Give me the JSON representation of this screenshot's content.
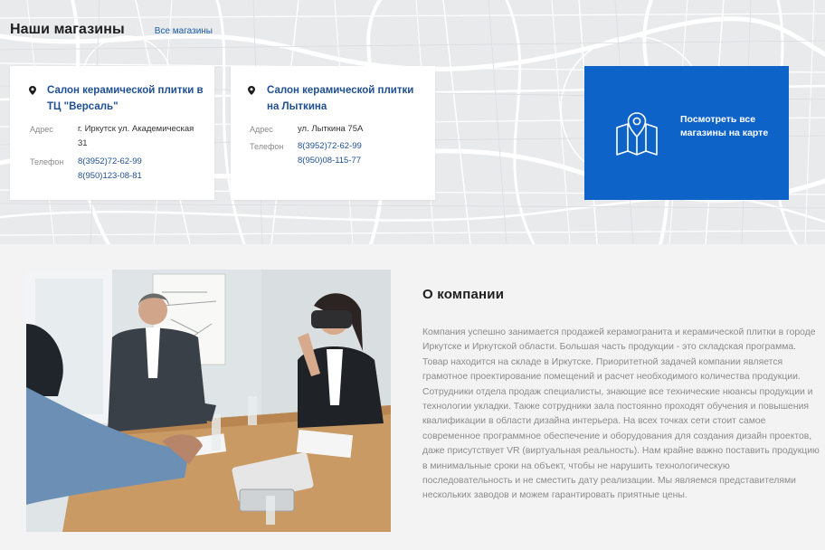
{
  "stores": {
    "title": "Наши магазины",
    "all_link": "Все магазины",
    "address_label": "Адрес",
    "phone_label": "Телефон",
    "items": [
      {
        "name": "Салон керамической плитки в ТЦ \"Версаль\"",
        "address": "г. Иркутск ул. Академическая 31",
        "phones": [
          "8(3952)72-62-99",
          "8(950)123-08-81"
        ]
      },
      {
        "name": "Салон керамической плитки на Лыткина",
        "address": "ул. Лыткина 75А",
        "phones": [
          "8(3952)72-62-99",
          "8(950)08-115-77"
        ]
      }
    ],
    "map_button": {
      "label": "Посмотреть все магазины на карте",
      "icon": "folded-map-pin-icon"
    }
  },
  "about": {
    "title": "О компании",
    "text": "Компания успешно занимается продажей керамогранита и керамической плитки в городе Иркутске и Иркутской области. Большая часть продукции - это складская программа. Товар находится на складе в Иркутске. Приоритетной задачей компании является грамотное проектирование помещений и расчет необходимого количества продукции. Сотрудники отдела продаж специалисты, знающие все технические нюансы продукции и технологии укладки. Также сотрудники зала постоянно проходят обучения и повышения квалификации в области дизайна интерьера. На всех точках сети стоит самое современное программное обеспечение и оборудования для создания дизайн проектов, даже присутствует VR (виртуальная реальность). Нам крайне важно поставить продукцию в минимальные сроки на объект, чтобы не нарушить технологическую последовательность и не сместить дату реализации. Мы являемся представителями нескольких заводов и можем гарантировать приятные цены."
  },
  "colors": {
    "accent": "#0e63c9",
    "link": "#1f4f93",
    "map_bg": "#e9eaec",
    "section_bg": "#f3f3f4",
    "body_text": "#8b8b8b"
  }
}
